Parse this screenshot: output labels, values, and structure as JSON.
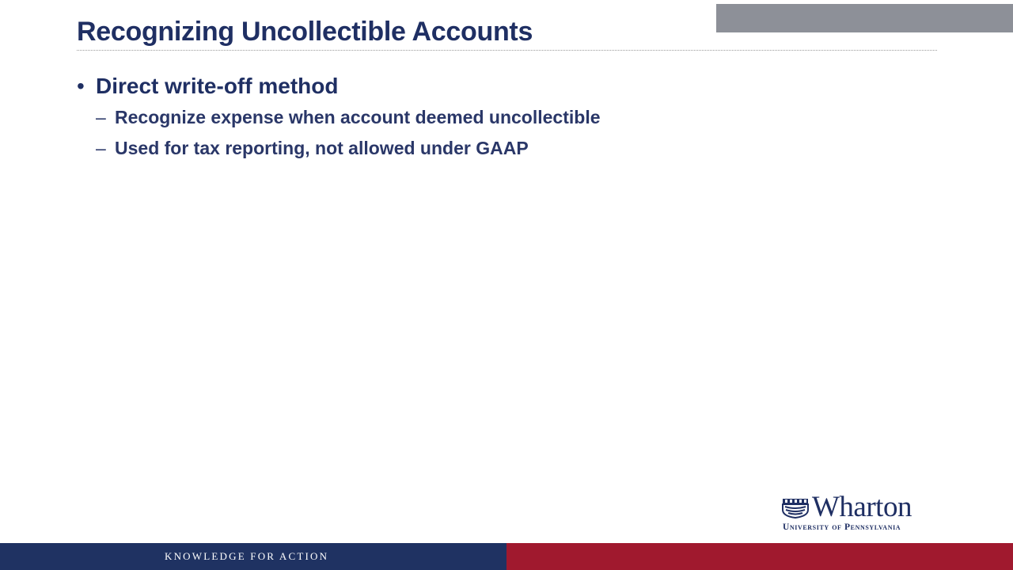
{
  "slide": {
    "title": "Recognizing Uncollectible Accounts",
    "bullets": [
      {
        "marker": "•",
        "text": "Direct write-off method",
        "sub_marker": "–",
        "sub": [
          "Recognize expense when account deemed uncollectible",
          "Used for tax reporting, not allowed under GAAP"
        ]
      }
    ]
  },
  "logo": {
    "wordmark": "Wharton",
    "subtitle": "University of Pennsylvania",
    "icon": "shield-icon"
  },
  "footer": {
    "tagline": "KNOWLEDGE FOR ACTION"
  },
  "colors": {
    "title": "#1f2f63",
    "header_block": "#8d9098",
    "footer_navy": "#1f3262",
    "footer_red": "#a0192e"
  }
}
